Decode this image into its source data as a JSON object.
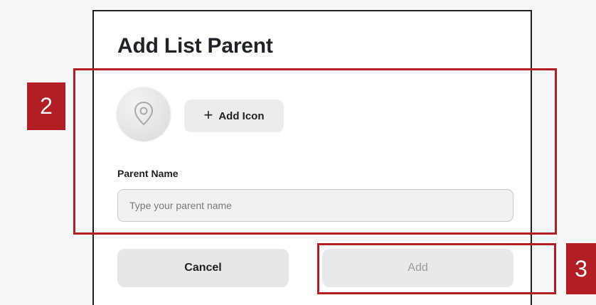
{
  "dialog": {
    "title": "Add List Parent",
    "add_icon_label": "Add Icon",
    "add_icon_symbol": "+",
    "field_label": "Parent Name",
    "input_placeholder": "Type your parent name",
    "input_value": "",
    "cancel_label": "Cancel",
    "add_label": "Add"
  },
  "annotations": {
    "region_2_label": "2",
    "region_3_label": "3"
  },
  "icons": {
    "avatar_icon": "location-pin-icon"
  },
  "colors": {
    "annotation_red": "#b21e24",
    "modal_border": "#1f1f1f",
    "button_bg": "#e7e7e7",
    "disabled_text": "#9a9a9a"
  }
}
